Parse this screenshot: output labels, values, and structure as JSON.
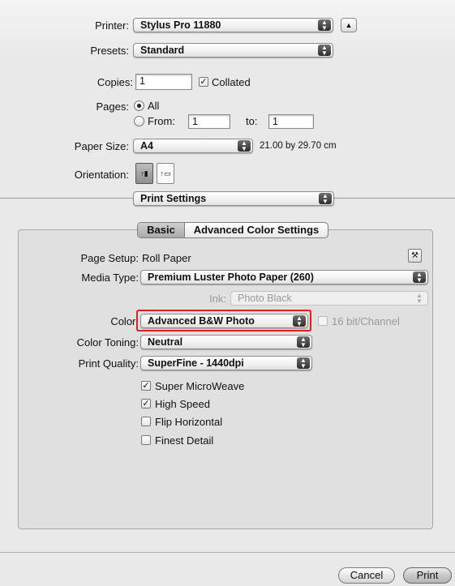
{
  "printer": {
    "label": "Printer:",
    "value": "Stylus Pro 11880"
  },
  "presets": {
    "label": "Presets:",
    "value": "Standard"
  },
  "copies": {
    "label": "Copies:",
    "value": "1",
    "collated_label": "Collated",
    "collated_checked": true
  },
  "pages": {
    "label": "Pages:",
    "all_label": "All",
    "from_label": "From:",
    "from_value": "1",
    "to_label": "to:",
    "to_value": "1"
  },
  "paper_size": {
    "label": "Paper Size:",
    "value": "A4",
    "dimensions": "21.00 by 29.70 cm"
  },
  "orientation": {
    "label": "Orientation:"
  },
  "section_popup": {
    "value": "Print Settings"
  },
  "tabs": {
    "basic": "Basic",
    "advanced": "Advanced Color Settings"
  },
  "settings": {
    "page_setup_label": "Page Setup:",
    "page_setup_value": "Roll Paper",
    "media_type_label": "Media Type:",
    "media_type_value": "Premium Luster Photo Paper (260)",
    "ink_label": "Ink:",
    "ink_value": "Photo Black",
    "color_label": "Color:",
    "color_value": "Advanced B&W Photo",
    "bit_label": "16 bit/Channel",
    "toning_label": "Color Toning:",
    "toning_value": "Neutral",
    "quality_label": "Print Quality:",
    "quality_value": "SuperFine - 1440dpi"
  },
  "options": [
    {
      "label": "Super MicroWeave",
      "checked": true
    },
    {
      "label": "High Speed",
      "checked": true
    },
    {
      "label": "Flip Horizontal",
      "checked": false
    },
    {
      "label": "Finest Detail",
      "checked": false
    }
  ],
  "buttons": {
    "cancel": "Cancel",
    "print": "Print"
  },
  "colors": {
    "highlight": "#e02020",
    "panel_bg": "#e0e0e0",
    "window_bg": "#e9e9e9"
  }
}
